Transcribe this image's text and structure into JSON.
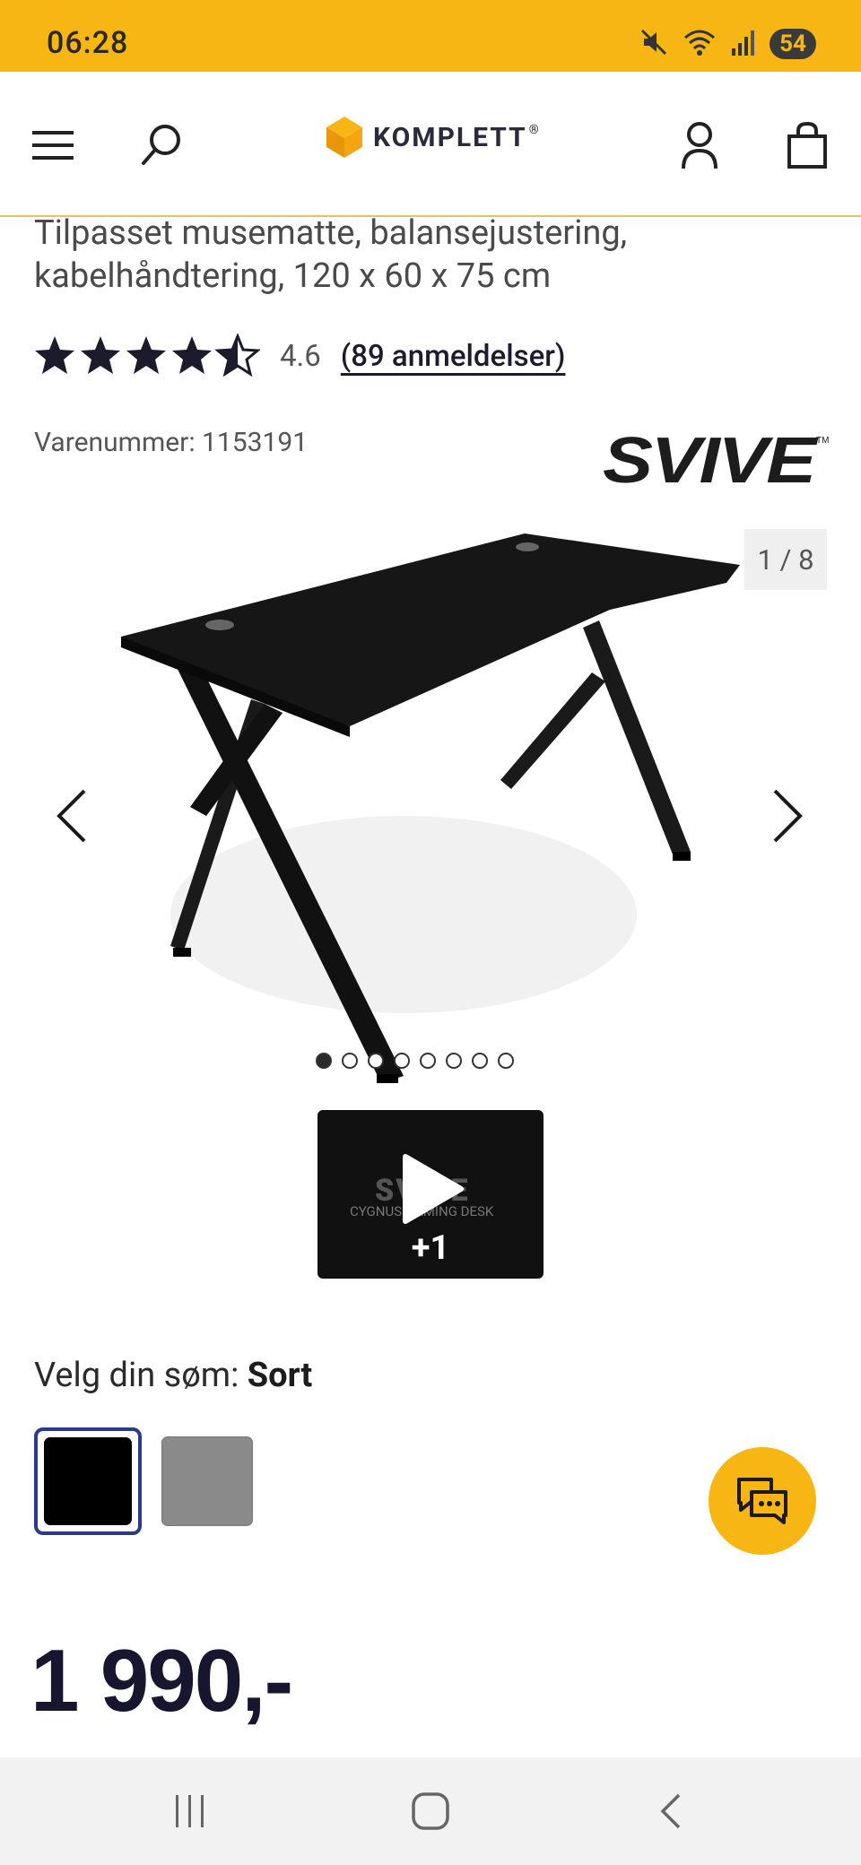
{
  "status_bar": {
    "time": "06:28",
    "battery": "54"
  },
  "header": {
    "logo_text": "KOMPLETT",
    "logo_mark": "®"
  },
  "product": {
    "subtitle": "Tilpasset musematte, balansejustering, kabelhåndtering, 120 x 60 x 75 cm",
    "rating_value": "4.6",
    "rating_fraction": 0.92,
    "reviews_label": "(89 anmeldelser)",
    "sku_label": "Varenummer: 1153191",
    "brand_logo_text": "SVIVE",
    "price": "1 990,-"
  },
  "gallery": {
    "counter": "1 / 8",
    "total_images": 8,
    "active_index": 0,
    "video_thumb": {
      "brand": "SVIVE",
      "caption": "CYGNUS GAMING DESK",
      "more_label": "+1"
    }
  },
  "options": {
    "label_prefix": "Velg din søm: ",
    "selected_value": "Sort",
    "swatches": [
      {
        "name": "Sort",
        "color": "#000000"
      },
      {
        "name": "Grå",
        "color": "#8a8a8a"
      }
    ]
  },
  "colors": {
    "accent": "#f7b614",
    "selection_border": "#2c3a8c",
    "price_text": "#16162e"
  }
}
